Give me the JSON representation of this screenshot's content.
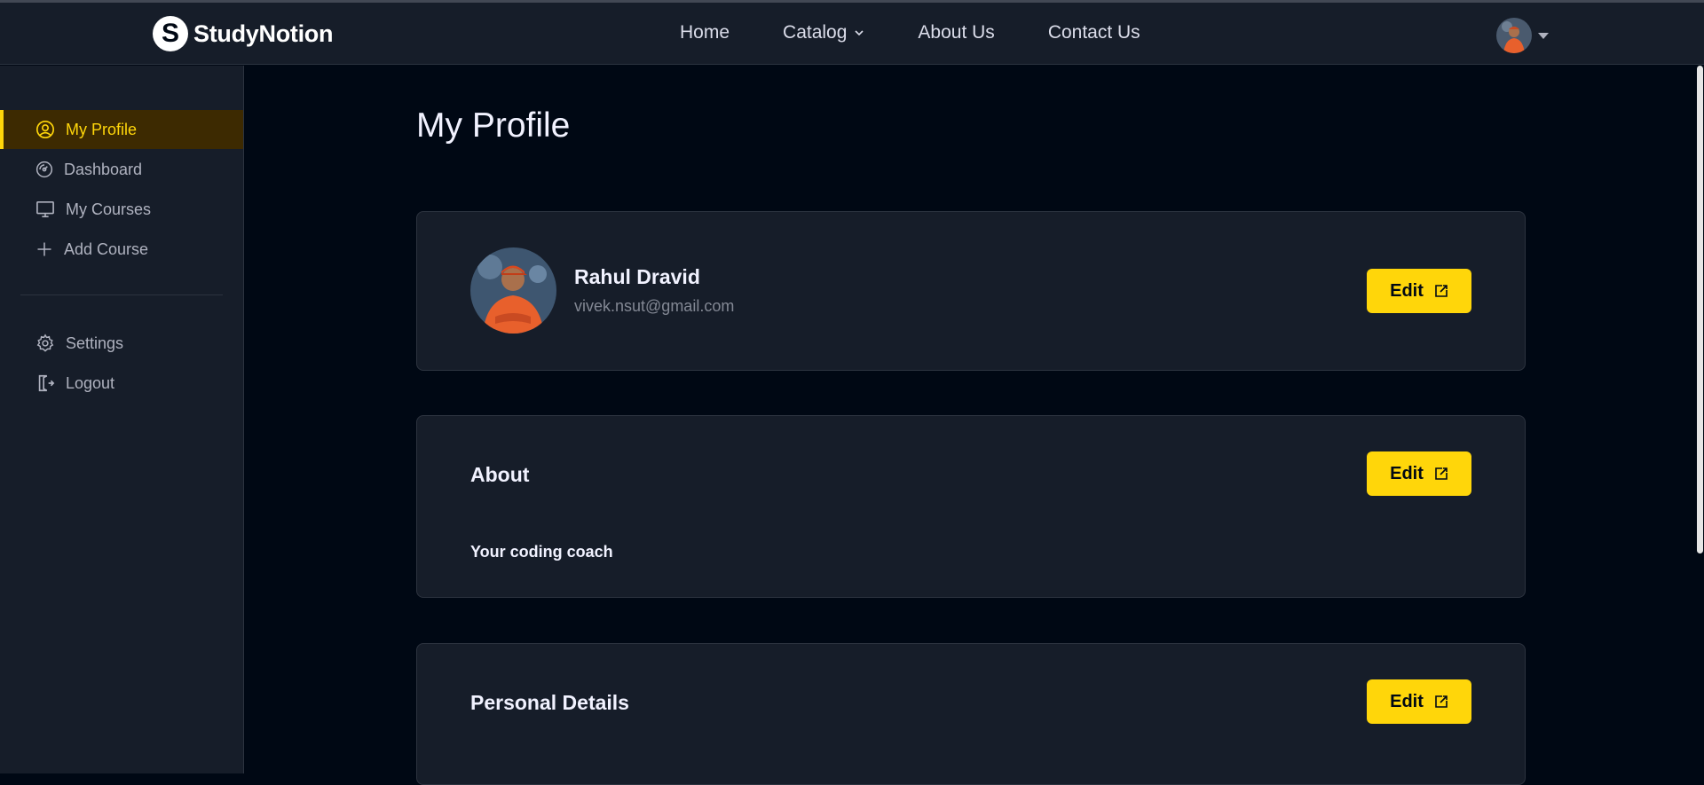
{
  "brand": {
    "name": "StudyNotion",
    "logo_letter": "S"
  },
  "nav": {
    "links": [
      {
        "label": "Home"
      },
      {
        "label": "Catalog"
      },
      {
        "label": "About Us"
      },
      {
        "label": "Contact Us"
      }
    ]
  },
  "sidebar": {
    "items": [
      {
        "label": "My Profile",
        "icon": "user-circle-icon",
        "active": true
      },
      {
        "label": "Dashboard",
        "icon": "gauge-icon"
      },
      {
        "label": "My Courses",
        "icon": "monitor-icon"
      },
      {
        "label": "Add Course",
        "icon": "plus-icon"
      }
    ],
    "bottom_items": [
      {
        "label": "Settings",
        "icon": "gear-icon"
      },
      {
        "label": "Logout",
        "icon": "logout-icon"
      }
    ]
  },
  "page": {
    "title": "My Profile"
  },
  "profile_card": {
    "name": "Rahul Dravid",
    "email": "vivek.nsut@gmail.com",
    "edit_label": "Edit"
  },
  "about_card": {
    "title": "About",
    "text": "Your coding coach",
    "edit_label": "Edit"
  },
  "personal_card": {
    "title": "Personal Details",
    "edit_label": "Edit"
  },
  "colors": {
    "accent": "#FFD60A",
    "background": "#000814",
    "panel": "#161D29",
    "active_bg": "#3D2A01"
  }
}
